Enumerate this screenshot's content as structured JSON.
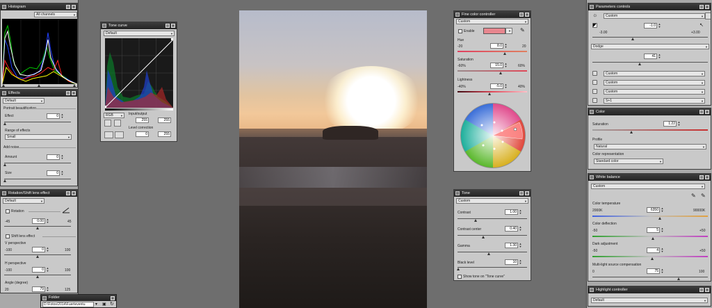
{
  "histogram": {
    "title": "Histogram",
    "channel": "All channels"
  },
  "effects": {
    "title": "Effects",
    "preset": "Default",
    "portrait": "Portrait beautification",
    "effect_label": "Effect",
    "effect_value": "0",
    "range_label": "Range of effects",
    "range_value": "Small",
    "noise_label": "Add noise",
    "amount_label": "Amount",
    "amount_value": "0",
    "size_label": "Size",
    "size_value": "0"
  },
  "rotation": {
    "title": "Rotation/Shift lens effect",
    "preset": "Default",
    "rotation_label": "Rotation",
    "rot_min": "-45",
    "rot_value": "0.00",
    "rot_max": "45",
    "shift_label": "Shift lens effect",
    "v_label": "V perspective",
    "v_min": "-100",
    "v_value": "0",
    "v_max": "100",
    "h_label": "H perspective",
    "h_min": "-100",
    "h_value": "0",
    "h_max": "100",
    "angle_label": "Angle (degree)",
    "angle_min": "20",
    "angle_value": "79",
    "angle_max": "125"
  },
  "folder": {
    "title": "Folder",
    "path": "D:\\Fotos\\2014\\Fuerteventu"
  },
  "tone_curve": {
    "title": "Tone curve",
    "preset": "Default",
    "channel": "RGB",
    "io_label": "Input/output",
    "in_value": "255",
    "out_value": "255",
    "level_label": "Level correction",
    "level_low": "0",
    "level_high": "255"
  },
  "fine_color": {
    "title": "Fine color controller",
    "preset": "Custom",
    "enable_label": "Enable",
    "swatch_color": "#e8878f",
    "hue_label": "Hue",
    "hue_min": "-20",
    "hue_value": "8.0",
    "hue_max": "20",
    "sat_label": "Saturation",
    "sat_min": "-60%",
    "sat_value": "15.0",
    "sat_max": "60%",
    "light_label": "Lightness",
    "light_min": "-40%",
    "light_value": "-5.0",
    "light_max": "40%"
  },
  "tone": {
    "title": "Tone",
    "preset": "Custom",
    "contrast_label": "Contrast",
    "contrast_value": "1.00",
    "center_label": "Contrast center",
    "center_value": "0.40",
    "gamma_label": "Gamma",
    "gamma_value": "1.30",
    "black_label": "Black level",
    "black_value": "10",
    "show_label": "Show tone on \"Tone curve\""
  },
  "params": {
    "title": "Parameters controls",
    "preset": "Custom",
    "ev_value": "-1.0",
    "ev_min": "-3.00",
    "ev_max": "+3.00",
    "dodge_label": "Dodge",
    "dodge_value": "41",
    "row1": "Custom",
    "row2": "Custom",
    "row3": "Custom",
    "row4": "S+1"
  },
  "color": {
    "title": "Color",
    "sat_label": "Saturation",
    "sat_value": "1.22",
    "profile_label": "Profile",
    "profile_value": "Natural",
    "rep_label": "Color representation",
    "rep_value": "Standard color"
  },
  "white_balance": {
    "title": "White balance",
    "preset": "Custom",
    "temp_label": "Color temperature",
    "temp_min": "2000K",
    "temp_value": "6350",
    "temp_max": "90000K",
    "defl_label": "Color deflection",
    "defl_min": "-50",
    "defl_value": "5",
    "defl_max": "+50",
    "dark_label": "Dark adjustment",
    "dark_min": "-50",
    "dark_value": "4",
    "dark_max": "+50",
    "multi_label": "Multi-light source compensation",
    "multi_min": "0",
    "multi_value": "75",
    "multi_max": "100"
  },
  "highlight": {
    "title": "Highlight controller",
    "preset": "Default"
  }
}
